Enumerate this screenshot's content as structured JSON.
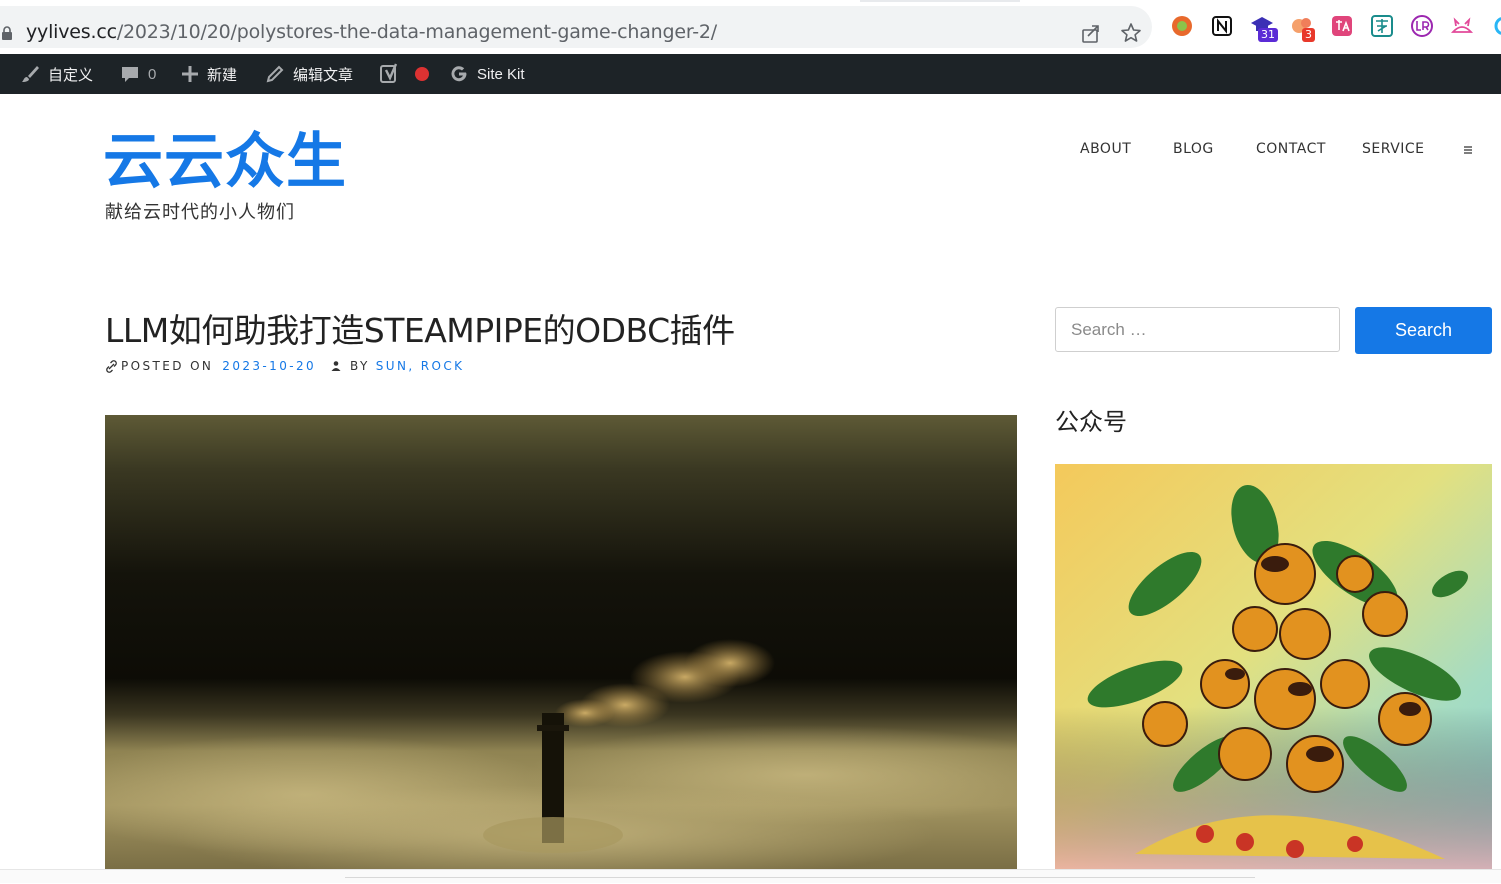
{
  "browser": {
    "url_host": "yylives.cc",
    "url_path": "/2023/10/20/polystores-the-data-management-game-changer-2/",
    "extension_badges": [
      "31",
      "3"
    ],
    "extensions": [
      "chrome-record-icon",
      "notion-icon",
      "graduation-cap-icon",
      "cloud-icon",
      "translate-icon",
      "dictionary-icon",
      "lr-icon",
      "cat-icon"
    ]
  },
  "adminbar": {
    "customize": "自定义",
    "comments_count": "0",
    "new": "新建",
    "edit_post": "编辑文章",
    "site_kit": "Site Kit"
  },
  "site": {
    "title": "云云众生",
    "tagline": "献给云时代的小人物们"
  },
  "nav": {
    "items": [
      "ABOUT",
      "BLOG",
      "CONTACT",
      "SERVICE"
    ]
  },
  "post": {
    "title": "LLM如何助我打造STEAMPIPE的ODBC插件",
    "posted_on_label": "POSTED ON",
    "date": "2023-10-20",
    "by_label": "BY",
    "author": "SUN, ROCK"
  },
  "sidebar": {
    "search_placeholder": "Search …",
    "search_button": "Search",
    "widget_title": "公众号"
  },
  "colors": {
    "accent": "#1578e6",
    "adminbar": "#1d2327",
    "badge_purple": "#5b2bd6",
    "badge_red": "#e8392b"
  }
}
